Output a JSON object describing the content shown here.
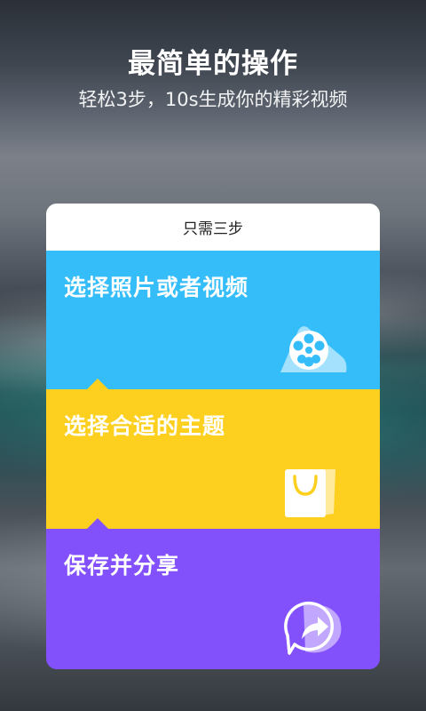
{
  "header": {
    "title": "最简单的操作",
    "subtitle": "轻松3步，10s生成你的精彩视频"
  },
  "card": {
    "title": "只需三步",
    "steps": [
      {
        "label": "选择照片或者视频",
        "icon": "video-reel-icon",
        "color": "#35bdf9"
      },
      {
        "label": "选择合适的主题",
        "icon": "shopping-bag-icon",
        "color": "#fdd020"
      },
      {
        "label": "保存并分享",
        "icon": "share-arrow-icon",
        "color": "#8351fc"
      }
    ]
  }
}
